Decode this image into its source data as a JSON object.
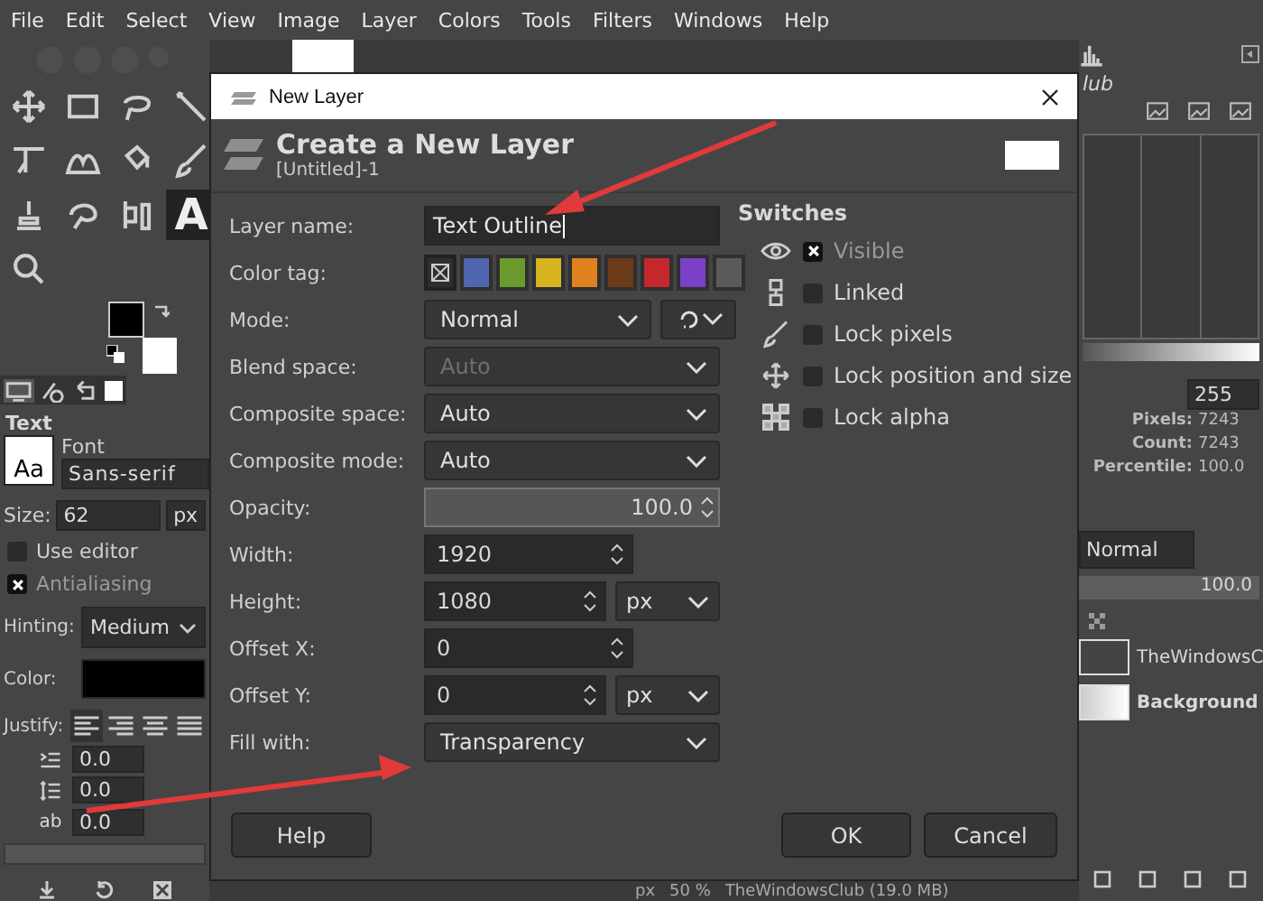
{
  "menubar": [
    "File",
    "Edit",
    "Select",
    "View",
    "Image",
    "Layer",
    "Colors",
    "Tools",
    "Filters",
    "Windows",
    "Help"
  ],
  "toolbox": {
    "tools": [
      {
        "kind": "move",
        "selected": false
      },
      {
        "kind": "rect-select",
        "selected": false
      },
      {
        "kind": "lasso",
        "selected": false
      },
      {
        "kind": "wand",
        "selected": false
      },
      {
        "kind": "transform",
        "selected": false
      },
      {
        "kind": "warp",
        "selected": false
      },
      {
        "kind": "bucket",
        "selected": false
      },
      {
        "kind": "brush",
        "selected": false
      },
      {
        "kind": "stamp",
        "selected": false
      },
      {
        "kind": "smudge",
        "selected": false
      },
      {
        "kind": "paths",
        "selected": false
      },
      {
        "kind": "text",
        "glyph": "A",
        "selected": true
      },
      {
        "kind": "zoom",
        "selected": false
      }
    ]
  },
  "tool_options": {
    "title": "Text",
    "font_preview": "Aa",
    "font_label": "Font",
    "font": "Sans-serif",
    "size_label": "Size:",
    "size": "62",
    "size_unit": "px",
    "checks": [
      {
        "label": "Use editor",
        "checked": false
      },
      {
        "label": "Antialiasing",
        "checked": true
      }
    ],
    "hinting_label": "Hinting:",
    "hinting": "Medium",
    "color_label": "Color:",
    "justify_label": "Justify:",
    "justify": [
      {
        "kind": "left",
        "selected": true
      },
      {
        "kind": "right",
        "selected": false
      },
      {
        "kind": "center",
        "selected": false
      },
      {
        "kind": "fill",
        "selected": false
      }
    ],
    "spacing": [
      {
        "kind": "indent",
        "value": "0.0"
      },
      {
        "kind": "line",
        "value": "0.0"
      },
      {
        "kind": "letter",
        "glyph": "ab",
        "value": "0.0"
      }
    ]
  },
  "dialog": {
    "title": "New Layer",
    "heading": "Create a New Layer",
    "subheading": "[Untitled]-1",
    "fields": [
      {
        "kind": "text",
        "label": "Layer name:",
        "value": "Text Outline"
      },
      {
        "kind": "tags",
        "label": "Color tag:",
        "tags": [
          {
            "kind": "none",
            "color": "#2f2f2f",
            "selected": true
          },
          {
            "kind": "color",
            "color": "#5066b0",
            "selected": false
          },
          {
            "kind": "color",
            "color": "#6b9a2c",
            "selected": false
          },
          {
            "kind": "color",
            "color": "#d6b420",
            "selected": false
          },
          {
            "kind": "color",
            "color": "#e0801e",
            "selected": false
          },
          {
            "kind": "color",
            "color": "#6a3a1a",
            "selected": false
          },
          {
            "kind": "color",
            "color": "#c4282c",
            "selected": false
          },
          {
            "kind": "color",
            "color": "#7a40c8",
            "selected": false
          },
          {
            "kind": "color",
            "color": "#5a5a5a",
            "selected": false
          }
        ]
      },
      {
        "kind": "select",
        "label": "Mode:",
        "value": "Normal",
        "extra": true,
        "disabled": false
      },
      {
        "kind": "select",
        "label": "Blend space:",
        "value": "Auto",
        "disabled": true
      },
      {
        "kind": "select",
        "label": "Composite space:",
        "value": "Auto",
        "disabled": false
      },
      {
        "kind": "select",
        "label": "Composite mode:",
        "value": "Auto",
        "disabled": false
      },
      {
        "kind": "slider",
        "label": "Opacity:",
        "value": "100.0",
        "level": 1
      },
      {
        "kind": "spin",
        "label": "Width:",
        "value": "1920"
      },
      {
        "kind": "spin",
        "label": "Height:",
        "value": "1080",
        "unit": "px"
      },
      {
        "kind": "spin",
        "label": "Offset X:",
        "value": "0"
      },
      {
        "kind": "spin",
        "label": "Offset Y:",
        "value": "0",
        "unit": "px"
      },
      {
        "kind": "select",
        "label": "Fill with:",
        "value": "Transparency",
        "disabled": false
      }
    ],
    "switches_title": "Switches",
    "switches": [
      {
        "kind": "eye",
        "label": "Visible",
        "checked": true,
        "disabled": true
      },
      {
        "kind": "chain",
        "label": "Linked",
        "checked": false,
        "disabled": false
      },
      {
        "kind": "brush",
        "label": "Lock pixels",
        "checked": false,
        "disabled": false
      },
      {
        "kind": "move",
        "label": "Lock position and size",
        "checked": false,
        "disabled": false
      },
      {
        "kind": "checker",
        "label": "Lock alpha",
        "checked": false,
        "disabled": false
      }
    ],
    "buttons": [
      {
        "kind": "help",
        "label": "Help"
      },
      {
        "kind": "ok",
        "label": "OK"
      },
      {
        "kind": "cancel",
        "label": "Cancel"
      }
    ]
  },
  "histogram": {
    "title_cut": "lub",
    "value": "255",
    "stats": [
      {
        "label": "Pixels:",
        "value": "7243"
      },
      {
        "label": "Count:",
        "value": "7243"
      },
      {
        "label": "Percentile:",
        "value": "100.0"
      }
    ]
  },
  "layers": {
    "mode": "Normal",
    "opacity": "100.0",
    "level": 1,
    "items": [
      {
        "kind": "text",
        "name": "TheWindowsC"
      },
      {
        "kind": "image",
        "name": "Background"
      }
    ]
  },
  "status_bar": {
    "unit": "px",
    "zoom": "50 %",
    "info": "TheWindowsClub (19.0 MB)"
  }
}
